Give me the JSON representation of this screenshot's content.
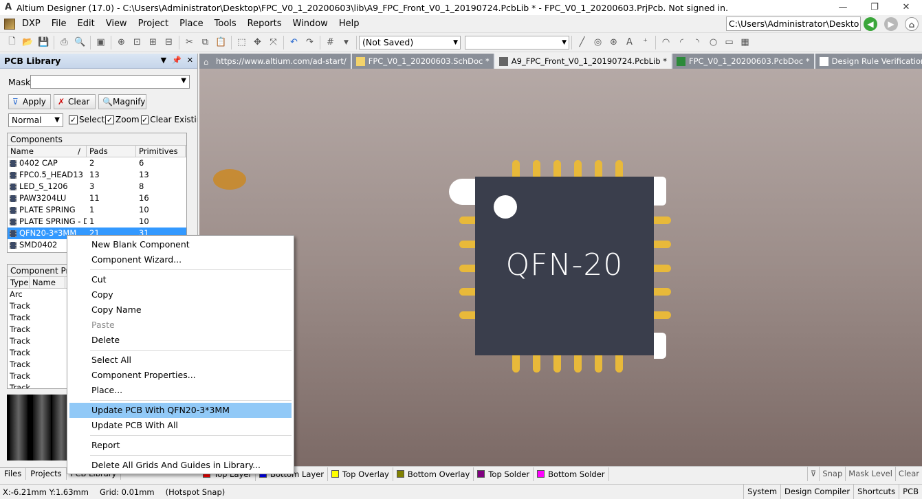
{
  "window": {
    "title": "Altium Designer (17.0) - C:\\Users\\Administrator\\Desktop\\FPC_V0_1_20200603\\lib\\A9_FPC_Front_V0_1_20190724.PcbLib * - FPC_V0_1_20200603.PrjPcb. Not signed in.",
    "minimize": "—",
    "maximize": "❐",
    "close": "✕"
  },
  "menu": {
    "items": [
      "DXP",
      "File",
      "Edit",
      "View",
      "Project",
      "Place",
      "Tools",
      "Reports",
      "Window",
      "Help"
    ],
    "path": "C:\\Users\\Administrator\\Deskto"
  },
  "toolbar": {
    "saved_state": "(Not Saved)"
  },
  "panel": {
    "title": "PCB Library",
    "mask_label": "Mask",
    "apply": "Apply",
    "clear": "Clear",
    "magnify": "Magnify",
    "mode": "Normal",
    "select": "Select",
    "zoom": "Zoom",
    "clear_existing": "Clear Existing",
    "components_title": "Components",
    "headers": [
      "Name",
      "Pads",
      "Primitives"
    ],
    "components": [
      {
        "name": "0402 CAP",
        "pads": "2",
        "prims": "6"
      },
      {
        "name": "FPC0.5_HEAD13",
        "pads": "13",
        "prims": "13"
      },
      {
        "name": "LED_S_1206",
        "pads": "3",
        "prims": "8"
      },
      {
        "name": "PAW3204LU",
        "pads": "11",
        "prims": "16"
      },
      {
        "name": "PLATE SPRING",
        "pads": "1",
        "prims": "10"
      },
      {
        "name": "PLATE SPRING - DU",
        "pads": "1",
        "prims": "10"
      },
      {
        "name": "QFN20-3*3MM",
        "pads": "21",
        "prims": "31"
      },
      {
        "name": "SMD0402",
        "pads": "",
        "prims": ""
      }
    ],
    "prims_title": "Component Prim",
    "prims_headers": [
      "Type",
      "Name"
    ],
    "primitives": [
      "Arc",
      "Track",
      "Track",
      "Track",
      "Track",
      "Track",
      "Track",
      "Track",
      "Track"
    ],
    "tabs": [
      "Files",
      "Projects",
      "PCB Library"
    ]
  },
  "doctabs": [
    {
      "label": "https://www.altium.com/ad-start/",
      "active": false
    },
    {
      "label": "FPC_V0_1_20200603.SchDoc *",
      "active": false
    },
    {
      "label": "A9_FPC_Front_V0_1_20190724.PcbLib *",
      "active": true
    },
    {
      "label": "FPC_V0_1_20200603.PcbDoc *",
      "active": false
    },
    {
      "label": "Design Rule Verification Report",
      "active": false
    }
  ],
  "canvas": {
    "component_label": "QFN-20"
  },
  "context_menu": {
    "groups": [
      [
        {
          "label": "New Blank Component"
        },
        {
          "label": "Component Wizard..."
        }
      ],
      [
        {
          "label": "Cut"
        },
        {
          "label": "Copy"
        },
        {
          "label": "Copy Name"
        },
        {
          "label": "Paste",
          "disabled": true
        },
        {
          "label": "Delete"
        }
      ],
      [
        {
          "label": "Select All"
        },
        {
          "label": "Component Properties..."
        },
        {
          "label": "Place..."
        }
      ],
      [
        {
          "label": "Update PCB With QFN20-3*3MM",
          "hover": true
        },
        {
          "label": "Update PCB With All"
        }
      ],
      [
        {
          "label": "Report"
        }
      ],
      [
        {
          "label": "Delete All Grids And Guides in Library..."
        }
      ]
    ]
  },
  "layers": [
    {
      "name": "Top Layer",
      "color": "#ff0000"
    },
    {
      "name": "Bottom Layer",
      "color": "#0000ff"
    },
    {
      "name": "Top Overlay",
      "color": "#ffff00"
    },
    {
      "name": "Bottom Overlay",
      "color": "#808000"
    },
    {
      "name": "Top Solder",
      "color": "#800080"
    },
    {
      "name": "Bottom Solder",
      "color": "#ff00ff"
    }
  ],
  "layer_right": [
    "Snap",
    "Mask Level",
    "Clear"
  ],
  "status": {
    "coords": "X:-6.21mm Y:1.63mm",
    "grid": "Grid: 0.01mm",
    "snap": "(Hotspot Snap)",
    "right": [
      "System",
      "Design Compiler",
      "Shortcuts",
      "PCB"
    ]
  }
}
